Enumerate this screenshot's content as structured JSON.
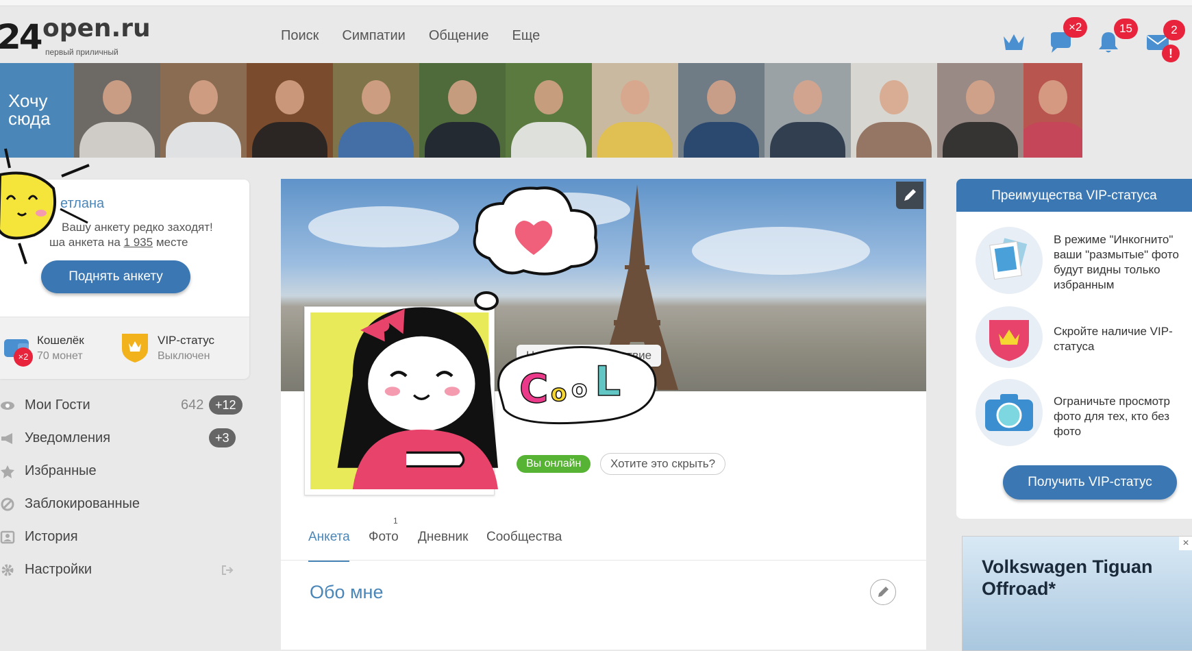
{
  "header": {
    "logo_num": "24",
    "logo_word": "open.ru",
    "logo_slogan": "первый приличный",
    "nav": [
      "Поиск",
      "Симпатии",
      "Общение",
      "Еще"
    ],
    "badges": {
      "messages": "×2",
      "notifications": "15",
      "mail": "2"
    },
    "icons": [
      "crown-icon",
      "chat-icon",
      "bell-icon",
      "mail-icon"
    ]
  },
  "strip": {
    "want_here": "Хочу сюда",
    "thumbs": [
      {
        "bg": "#6d6a66",
        "shirt": "#d9d7d2"
      },
      {
        "bg": "#8a6c53",
        "shirt": "#e8eef2"
      },
      {
        "bg": "#7a4b2c",
        "shirt": "#222222"
      },
      {
        "bg": "#80744b",
        "shirt": "#3c6fb0"
      },
      {
        "bg": "#4f6b3c",
        "shirt": "#1f2430"
      },
      {
        "bg": "#5b7a40",
        "shirt": "#ececec"
      },
      {
        "bg": "#c9b9a0",
        "shirt": "#e2c04a"
      },
      {
        "bg": "#6f7c86",
        "shirt": "#23426d"
      },
      {
        "bg": "#9aa2a6",
        "shirt": "#263447"
      },
      {
        "bg": "#d8d6d0",
        "shirt": "#8e6a58"
      },
      {
        "bg": "#9a8a86",
        "shirt": "#2a2a2a"
      },
      {
        "bg": "#b8554f",
        "shirt": "#c6455a"
      }
    ]
  },
  "profile_card": {
    "name": "етлана",
    "notice_line1": "Вашу анкету редко заходят!",
    "notice_line2_prefix": "ша анкета на",
    "place": "1 935",
    "notice_line2_suffix": "месте",
    "raise_button": "Поднять анкету",
    "wallet_title": "Кошелёк",
    "wallet_value": "70 монет",
    "wallet_badge": "×2",
    "vip_title": "VIP-статус",
    "vip_value": "Выключен"
  },
  "menu": [
    {
      "label": "Мои Гости",
      "count": "642",
      "badge": "+12",
      "icon": "eye-icon"
    },
    {
      "label": "Уведомления",
      "badge": "+3",
      "icon": "megaphone-icon"
    },
    {
      "label": "Избранные",
      "icon": "star-icon"
    },
    {
      "label": "Заблокированные",
      "icon": "block-icon"
    },
    {
      "label": "История",
      "icon": "history-icon"
    },
    {
      "label": "Настройки",
      "icon": "gear-icon"
    }
  ],
  "main": {
    "greeting_placeholder": "Напишите приветствие",
    "online_label": "Вы онлайн",
    "hide_button": "Хотите это скрыть?",
    "tabs": [
      "Анкета",
      "Фото",
      "Дневник",
      "Сообщества"
    ],
    "photo_count": "1",
    "about_title": "Обо мне"
  },
  "vip": {
    "title": "Преимущества VIP-статуса",
    "features": [
      "В режиме \"Инкогнито\" ваши \"размытые\" фото будут видны только избранным",
      "Скройте наличие VIP-статуса",
      "Ограничьте просмотр фото для тех, кто без фото"
    ],
    "button": "Получить VIP-статус"
  },
  "ad": {
    "title": "Volkswagen Tiguan Offroad*"
  },
  "colors": {
    "accent": "#3b78b3",
    "link": "#4a86b8",
    "badge": "#e8243c",
    "online": "#57b333"
  }
}
